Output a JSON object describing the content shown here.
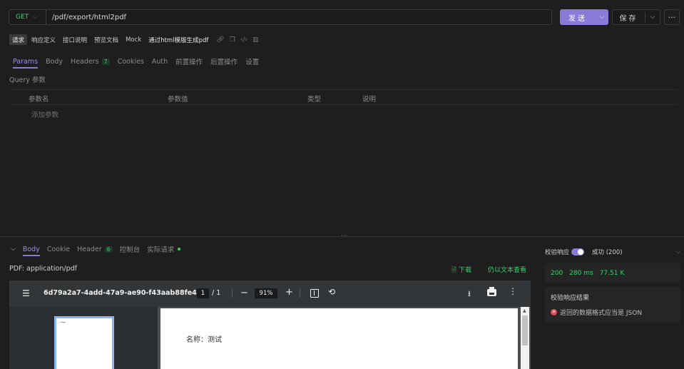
{
  "request": {
    "method": "GET",
    "url": "/pdf/export/html2pdf",
    "send_label": "发送",
    "save_label": "保存",
    "more_label": "···"
  },
  "doc_tabs": [
    {
      "label": "请求",
      "active": true
    },
    {
      "label": "响应定义"
    },
    {
      "label": "接口说明"
    },
    {
      "label": "预览文档"
    },
    {
      "label": "Mock"
    }
  ],
  "doc_title": "通过html模版生成pdf",
  "param_tabs": [
    {
      "label": "Params",
      "active": true
    },
    {
      "label": "Body"
    },
    {
      "label": "Headers",
      "badge": "7"
    },
    {
      "label": "Cookies"
    },
    {
      "label": "Auth"
    },
    {
      "label": "前置操作"
    },
    {
      "label": "后置操作"
    },
    {
      "label": "设置"
    }
  ],
  "query": {
    "section_label": "Query 参数",
    "columns": [
      "参数名",
      "参数值",
      "类型",
      "说明"
    ],
    "add_label": "添加参数"
  },
  "response_tabs": [
    {
      "label": "Body",
      "active": true
    },
    {
      "label": "Cookie"
    },
    {
      "label": "Header",
      "badge": "6"
    },
    {
      "label": "控制台"
    },
    {
      "label": "实际请求"
    }
  ],
  "response": {
    "content_type": "PDF: application/pdf",
    "download_label": "下载",
    "text_view_label": "仍以文本查看"
  },
  "pdf_viewer": {
    "file_name": "6d79a2a7-4add-47a9-ae90-f43aab88fe44",
    "current_page": "1",
    "total_pages": "/ 1",
    "zoom": "91%",
    "page_text": "名称：测试"
  },
  "validation": {
    "label": "校验响应",
    "enabled": true,
    "status_text": "成功 (200)",
    "status_code": "200",
    "time": "280 ms",
    "size": "77.51 K",
    "result_title": "校验响应结果",
    "result_message": "返回的数据格式应当是 JSON"
  },
  "colors": {
    "accent": "#8a7bd8",
    "success": "#3ccf6e",
    "error": "#e5484d",
    "background": "#1e1e1e"
  }
}
